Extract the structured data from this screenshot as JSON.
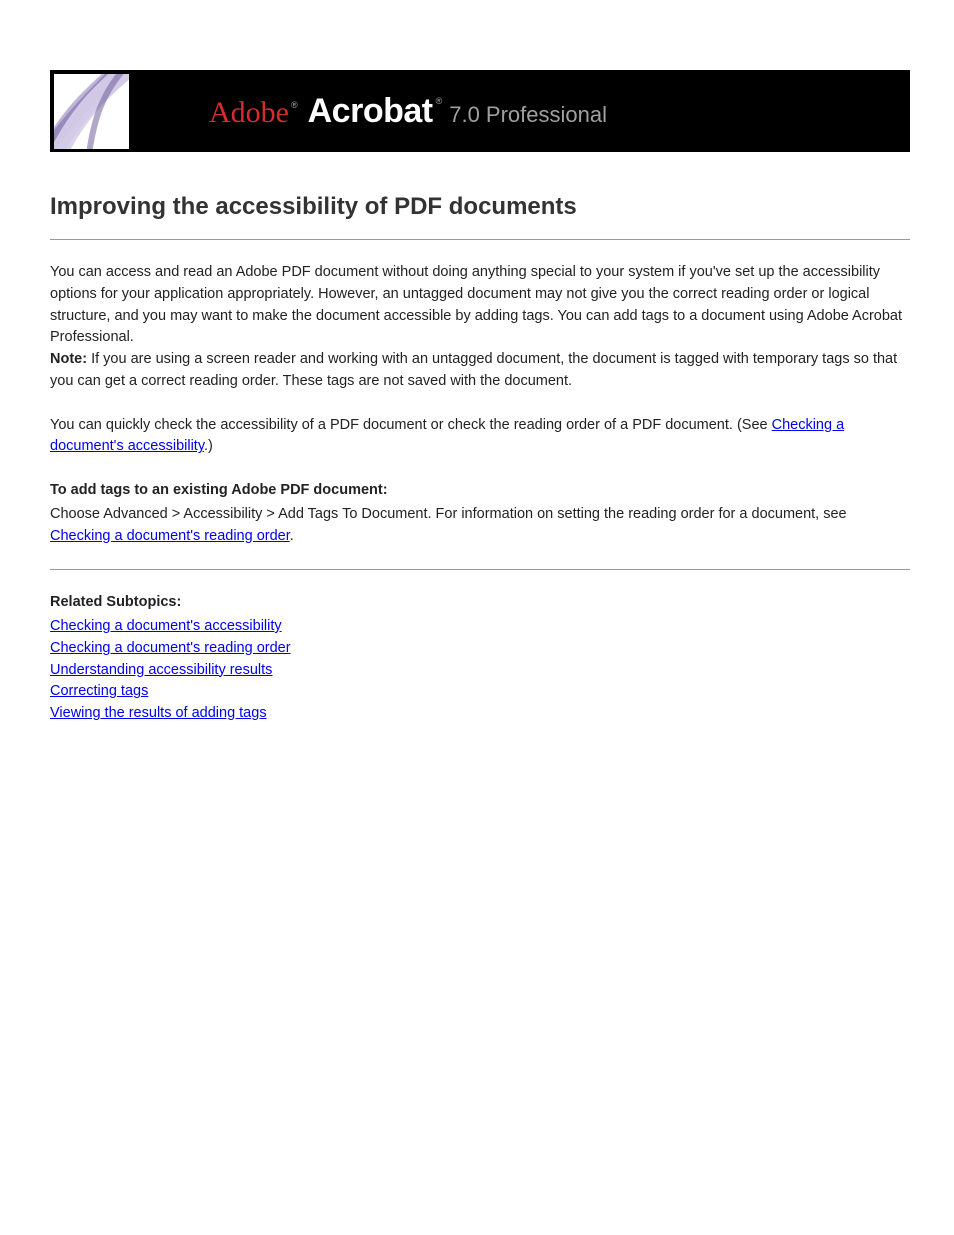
{
  "banner": {
    "brand_left": "Adobe",
    "brand_right": "Acrobat",
    "version_suffix": "7.0 Professional",
    "reg_symbol": "®"
  },
  "title": "Improving the accessibility of PDF documents",
  "paragraphs": {
    "p1": "You can access and read an Adobe PDF document without doing anything special to your system if you've set up the accessibility options for your application appropriately. However, an untagged document may not give you the correct reading order or logical structure, and you may want to make the document accessible by adding tags. You can add tags to a document using Adobe Acrobat Professional. ",
    "p1_note": "Note: ",
    "p1_note_text": "If you are using a screen reader and working with an untagged document, the document is tagged with temporary tags so that you can get a correct reading order. These tags are not saved with the document.",
    "p2_intro": "You can quickly check the accessibility of a PDF document or check the reading order of a PDF document. (See ",
    "p2_link": "Checking a document's accessibility",
    "p2_after": ".)"
  },
  "to_add_tags": {
    "heading": "To add tags to an existing Adobe PDF document:",
    "step_intro": "Choose Advanced > Accessibility > Add Tags To Document. For information on setting the reading order for a document, see ",
    "step_link": "Checking a document's reading order",
    "step_after": "."
  },
  "subtopics": {
    "heading": "Related Subtopics:",
    "items": [
      "Checking a document's accessibility",
      "Checking a document's reading order",
      "Understanding accessibility results",
      "Correcting tags",
      "Viewing the results of adding tags"
    ]
  }
}
